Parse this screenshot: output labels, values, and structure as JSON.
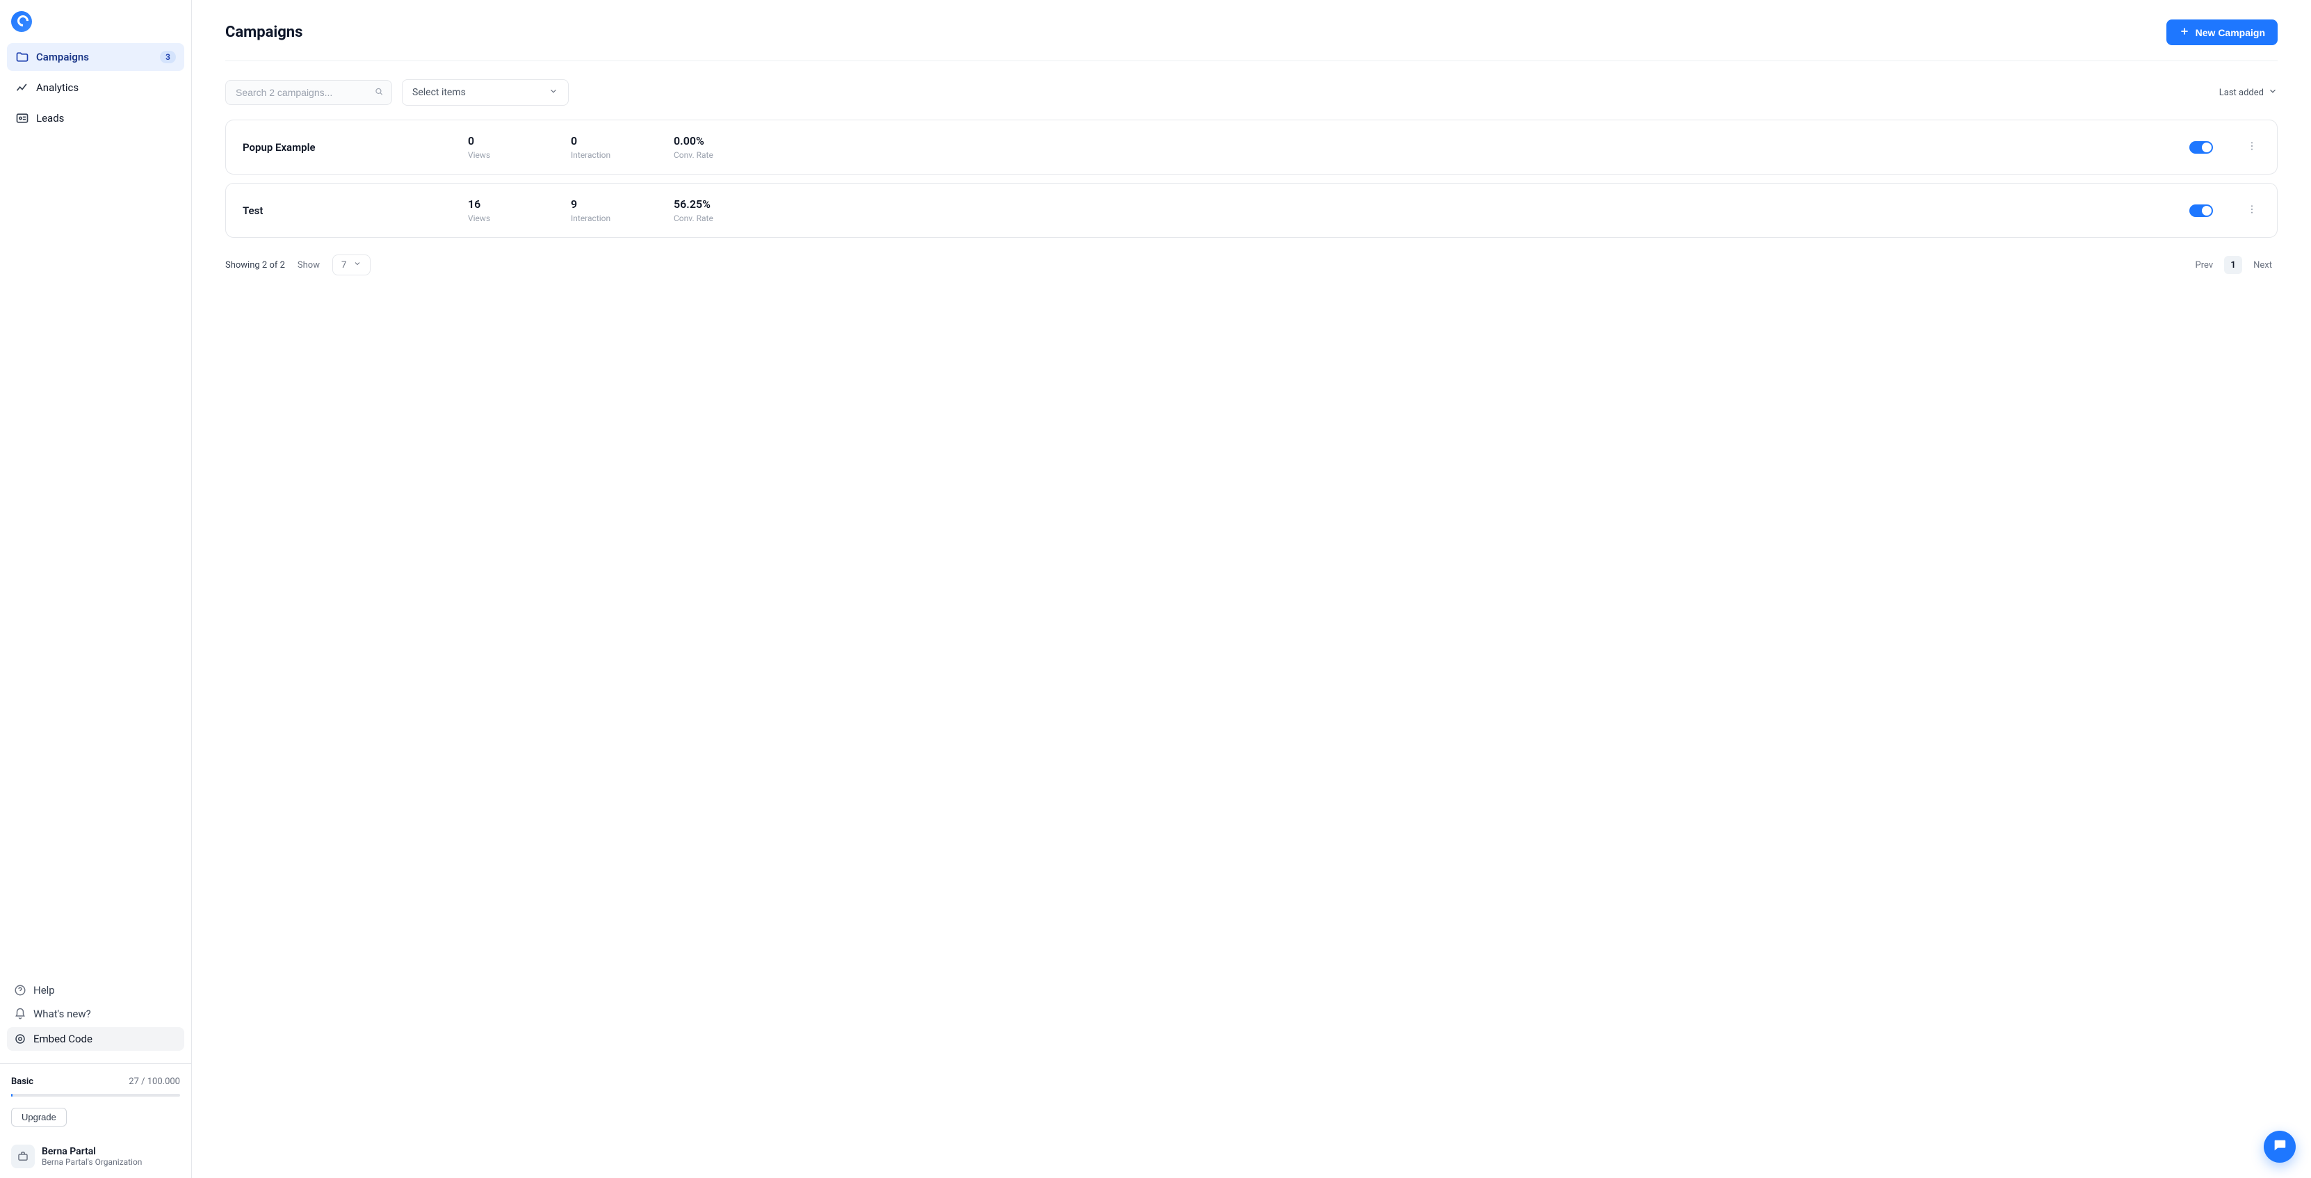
{
  "sidebar": {
    "nav": [
      {
        "label": "Campaigns",
        "badge": "3",
        "active": true
      },
      {
        "label": "Analytics"
      },
      {
        "label": "Leads"
      }
    ],
    "bottom": {
      "help": "Help",
      "whats_new": "What's new?",
      "embed_code": "Embed Code"
    },
    "plan": {
      "tier": "Basic",
      "usage": "27 / 100.000",
      "upgrade_label": "Upgrade"
    },
    "profile": {
      "name": "Berna Partal",
      "org": "Berna Partal's Organization"
    }
  },
  "header": {
    "title": "Campaigns",
    "new_campaign_label": "New Campaign"
  },
  "toolbar": {
    "search_placeholder": "Search 2 campaigns...",
    "select_items_label": "Select items",
    "sort_label": "Last added"
  },
  "labels": {
    "views": "Views",
    "interaction": "Interaction",
    "conv_rate": "Conv. Rate"
  },
  "campaigns": [
    {
      "name": "Popup Example",
      "views": "0",
      "interaction": "0",
      "conv_rate": "0.00%",
      "enabled": true
    },
    {
      "name": "Test",
      "views": "16",
      "interaction": "9",
      "conv_rate": "56.25%",
      "enabled": true
    }
  ],
  "footer": {
    "showing": "Showing 2 of 2",
    "show_label": "Show",
    "page_size": "7",
    "prev_label": "Prev",
    "page_number": "1",
    "next_label": "Next"
  }
}
